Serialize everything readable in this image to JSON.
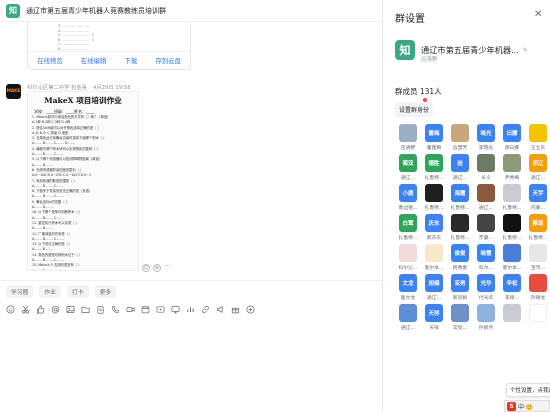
{
  "chat": {
    "title": "通辽市第五届青少年机器人竞赛教练员培训群",
    "group_avatar_glyph": "知",
    "file_card": {
      "lines": [
        "3.……………………",
        "4.……………………",
        "5.……………………（）",
        "6.……………………（）",
        "7.……………………",
        "8.……………………",
        "9.……………………"
      ],
      "actions": [
        "在线预览",
        "在线编辑",
        "下载",
        "存到云盘"
      ]
    },
    "message": {
      "sender": "科尔沁区第二中学 包金喜",
      "time": "4月29日 19:58",
      "avatar_text": "MAKE"
    },
    "doc": {
      "title": "MakeX 项目培训作业",
      "subtitle": "学校：____班级：____姓名：____",
      "lines": [
        "1. Mblock软件中添加角色的方式有（）种？（单选）",
        "A.1种   B.2种   C.3种   D.4种",
        "2. 按住Shift键可以对齐角色选择正确的是（ ）",
        "A.大 B.小 C.背景 D.造型",
        "3. 当角色运行到舞台边缘时选择下面哪个积木（ ）",
        "A.…… B.…… C.…… D.……",
        "4. 编程中哪个积木块可以实现角色的旋转（ ）",
        "A.……  B.……  C.……",
        "5. 以下哪个传感器可以检测障碍物距离（单选）",
        "A.……  B.……",
        "6. 光线传感器的返回值范围为（ ）",
        "A.0~100 B.0~255 C.0~1023 D.0~1",
        "7. 电机转速的取值范围是（ ）",
        "A.…… B.…… C.……",
        "8. 下面关于变量的说法正确的是（多选）",
        "A.……  B.……  C.……",
        "9. 舞台坐标x的范围（ ）",
        "A.……  B.……",
        "10. 以下哪个是条件判断积木（ ）",
        "A.……  B.……  C.……",
        "11. 重复执行积木可以实现（ ）",
        "A.……  B.……",
        "12. 广播消息的作用是（ ）",
        "A.……  B.……  C.……",
        "13. 以下说法正确的是（ ）",
        "A.……  B.……",
        "14. 角色的造型切换积木位于（ ）",
        "A.……  B.……  C.……",
        "15. Mblock 5 支持的语言有（ ）",
        "A.……  B.……",
        "16. ……………………（ ）",
        "17. ……………………（ ）",
        "18. ……………………（ ）"
      ]
    },
    "quick_tabs": [
      "学习圈",
      "作业",
      "打卡",
      "更多"
    ],
    "toolbar_icons": [
      "smile-icon",
      "scissors-icon",
      "thumb-icon",
      "at-icon",
      "image-icon",
      "folder-icon",
      "clipboard-icon",
      "phone-icon",
      "video-icon",
      "calendar-icon",
      "live-icon",
      "screen-icon",
      "vote-icon",
      "link-icon",
      "notice-icon",
      "gift-icon",
      "plus-icon"
    ]
  },
  "settings": {
    "title": "群设置",
    "group_name": "通辽市第五届青少年机器...",
    "group_owner": "吕清野",
    "member_count_label": "群成员 131人",
    "role_button_label": "设置群身份",
    "members": [
      {
        "name": "吕清野",
        "label": "",
        "color": "#9bb0c5"
      },
      {
        "name": "董建梅",
        "label": "董梅",
        "color": "#3b82f6"
      },
      {
        "name": "边慧芳",
        "label": "",
        "color": "#c7a77b"
      },
      {
        "name": "李晓光",
        "label": "晓光",
        "color": "#3b82f6"
      },
      {
        "name": "薛曰娜",
        "label": "曰娜",
        "color": "#3b82f6"
      },
      {
        "name": "王立东",
        "label": "",
        "color": "#f5c400"
      },
      {
        "name": "通辽...",
        "label": "蔺双",
        "color": "#2ea65a"
      },
      {
        "name": "扎鲁特...",
        "label": "德胜",
        "color": "#2ea65a"
      },
      {
        "name": "通辽...",
        "label": "岩",
        "color": "#3b82f6"
      },
      {
        "name": "长义",
        "label": "",
        "color": "#6e7b63"
      },
      {
        "name": "尹秀梅",
        "label": "",
        "color": "#8d9a7a"
      },
      {
        "name": "通辽...",
        "label": "祁辽",
        "color": "#f59e0b"
      },
      {
        "name": "鲁边德...",
        "label": "小鹿",
        "color": "#3b82f6"
      },
      {
        "name": "扎鲁特...",
        "label": "",
        "color": "#1f1f1f"
      },
      {
        "name": "扎鲁特...",
        "label": "海霞",
        "color": "#3b82f6"
      },
      {
        "name": "通辽...",
        "label": "",
        "color": "#8b5a3c"
      },
      {
        "name": "扎鲁特...",
        "label": "",
        "color": "#c9cdd3"
      },
      {
        "name": "内蒙...",
        "label": "天宇",
        "color": "#3b82f6"
      },
      {
        "name": "扎鲁特...",
        "label": "白鹭",
        "color": "#2ea65a"
      },
      {
        "name": "郝东东",
        "label": "庆东",
        "color": "#3b82f6"
      },
      {
        "name": "扎鲁特...",
        "label": "",
        "color": "#2a2a2a"
      },
      {
        "name": "奈曼...",
        "label": "",
        "color": "#444"
      },
      {
        "name": "扎鲁特...",
        "label": "",
        "color": "#111"
      },
      {
        "name": "扎鲁特...",
        "label": "蔡琼",
        "color": "#f59e0b"
      },
      {
        "name": "科尔沁...",
        "label": "",
        "color": "#f1d9dc"
      },
      {
        "name": "墨尔本...",
        "label": "",
        "color": "#f6e8c8"
      },
      {
        "name": "杨秀委",
        "label": "俊俊",
        "color": "#3b82f6"
      },
      {
        "name": "科尔...",
        "label": "晓雪",
        "color": "#3b82f6"
      },
      {
        "name": "墨尔本...",
        "label": "",
        "color": "#4a7dd8"
      },
      {
        "name": "宝市...",
        "label": "",
        "color": "#e7e7e7"
      },
      {
        "name": "殷文龙",
        "label": "文龙",
        "color": "#3b82f6"
      },
      {
        "name": "通辽...",
        "label": "旭娟",
        "color": "#3b82f6"
      },
      {
        "name": "新风娟",
        "label": "亚男",
        "color": "#3b82f6"
      },
      {
        "name": "付光华",
        "label": "光华",
        "color": "#3b82f6"
      },
      {
        "name": "李德...",
        "label": "辛松",
        "color": "#3b82f6"
      },
      {
        "name": "孙德龙",
        "label": "",
        "color": "#e74c3c"
      },
      {
        "name": "通辽...",
        "label": "",
        "color": "#5c8fd6"
      },
      {
        "name": "天祥",
        "label": "天祥",
        "color": "#3b82f6"
      },
      {
        "name": "常劲...",
        "label": "",
        "color": "#6f90c9"
      },
      {
        "name": "孙新月",
        "label": "",
        "color": "#8fb2e0"
      },
      {
        "name": "",
        "label": "",
        "color": "#c9cdd3"
      },
      {
        "name": "",
        "label": "",
        "color": "#ffffff"
      }
    ]
  },
  "tooltip": "个性设置，点我进",
  "ime": {
    "logo": "S",
    "text": "中·🙂"
  }
}
